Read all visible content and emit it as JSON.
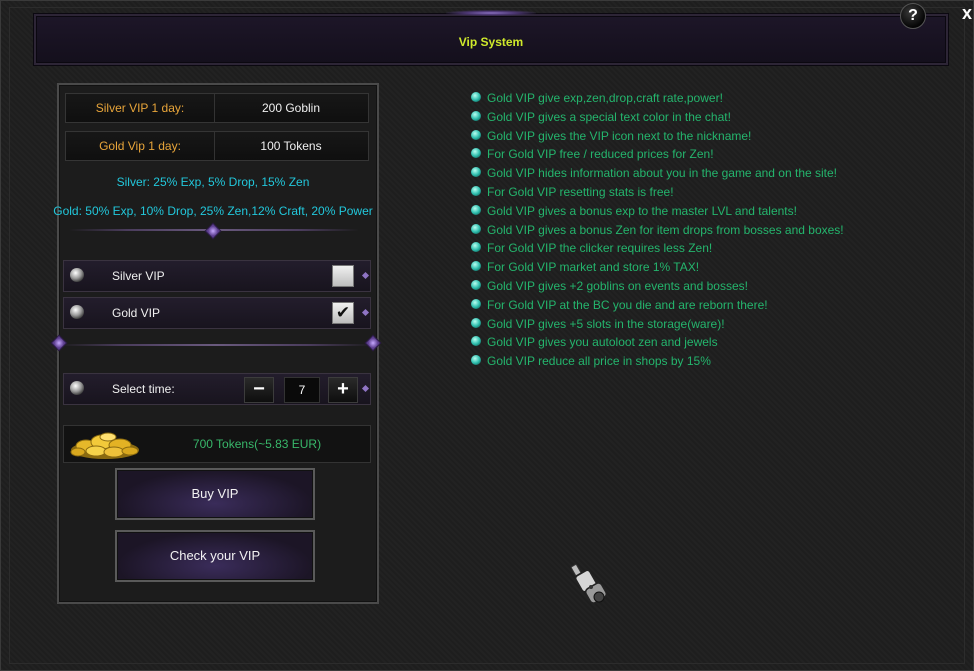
{
  "window": {
    "title": "Vip System",
    "help_label": "?",
    "close_label": "x"
  },
  "prices": [
    {
      "label": "Silver VIP 1 day:",
      "value": "200 Goblin"
    },
    {
      "label": "Gold Vip 1 day:",
      "value": "100 Tokens"
    }
  ],
  "bonuses": {
    "silver": "Silver: 25% Exp, 5% Drop, 15% Zen",
    "gold": "Gold: 50% Exp, 10% Drop, 25% Zen,12% Craft, 20% Power"
  },
  "options": [
    {
      "label": "Silver VIP",
      "checked": false
    },
    {
      "label": "Gold VIP",
      "checked": true
    }
  ],
  "check_mark": "✔",
  "time": {
    "label": "Select time:",
    "minus": "−",
    "plus": "+",
    "value": "7"
  },
  "total": "700 Tokens(~5.83 EUR)",
  "buttons": {
    "buy": "Buy VIP",
    "check": "Check your VIP"
  },
  "features": [
    "Gold VIP give exp,zen,drop,craft rate,power!",
    "Gold VIP gives a special text color in the chat!",
    "Gold VIP gives the VIP icon next to the nickname!",
    "For Gold VIP free / reduced prices for Zen!",
    "Gold VIP hides information about you in the game and on the site!",
    "For Gold VIP resetting stats is free!",
    "Gold VIP gives a bonus exp to the master LVL and talents!",
    "Gold VIP gives a bonus Zen for item drops from bosses and boxes!",
    "For Gold VIP the clicker requires less Zen!",
    "For Gold VIP market and store 1% TAX!",
    "Gold VIP gives +2 goblins on events and bosses!",
    "For Gold VIP at the BC you die and are reborn there!",
    "Gold VIP gives +5 slots in the storage(ware)!",
    "Gold VIP gives you autoloot zen and jewels",
    "Gold VIP reduce all price in shops by 15%"
  ],
  "colors": {
    "title": "#cfe92b",
    "price_label": "#e8a53a",
    "bonus_text": "#22c8dc",
    "feature_text": "#24b56d",
    "total_text": "#38b76a"
  }
}
